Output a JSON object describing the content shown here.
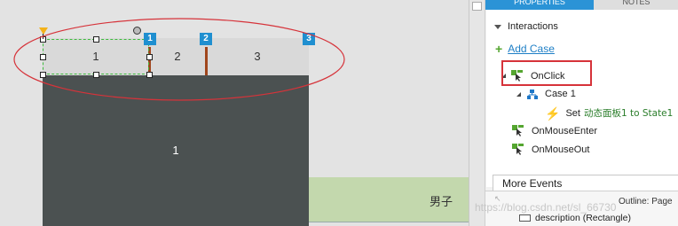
{
  "canvas": {
    "tabs": [
      {
        "label": "1",
        "badge": "1"
      },
      {
        "label": "2",
        "badge": "2"
      },
      {
        "label": "3",
        "badge": "3"
      }
    ],
    "panel_state_label": "1",
    "green_strip_text": "男子"
  },
  "panel": {
    "tab_properties": "PROPERTIES",
    "tab_notes": "NOTES",
    "interactions_title": "Interactions",
    "add_case": "Add Case",
    "events": {
      "onclick": "OnClick",
      "case1": "Case 1",
      "action_set": "Set",
      "action_target": "动态面板1 to State1",
      "onmouseenter": "OnMouseEnter",
      "onmouseout": "OnMouseOut"
    },
    "more_events": "More Events",
    "outline_title": "Outline: Page",
    "outline_item": "description (Rectangle)"
  },
  "watermark": "https://blog.csdn.net/sl_66730",
  "colors": {
    "badge": "#1f8fd0",
    "dark_panel": "#4b5151",
    "highlight_red": "#d6333a",
    "event_green": "#55a630",
    "selection_green": "#3dbb3d",
    "accent_tab": "#2b93d6"
  },
  "icons": {
    "event": "cursor-event-icon",
    "case": "case-tree-icon",
    "action": "lightning-icon",
    "add": "plus-icon"
  }
}
